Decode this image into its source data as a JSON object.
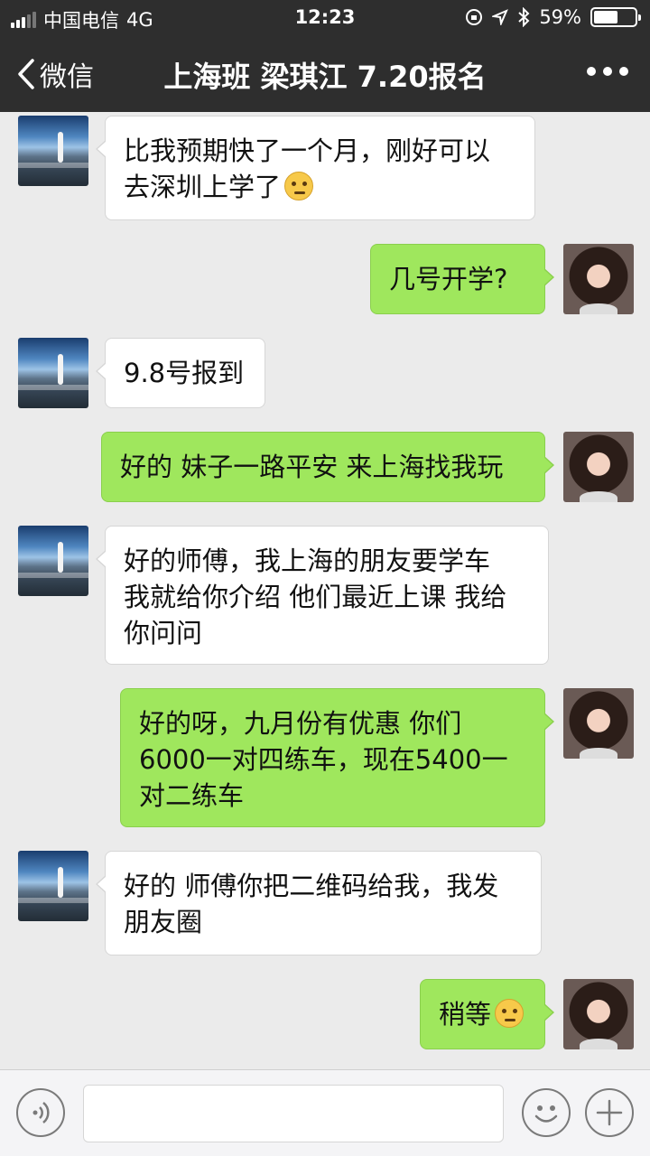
{
  "status_bar": {
    "carrier": "中国电信",
    "network": "4G",
    "time": "12:23",
    "battery_percent": "59%",
    "battery_level": 0.59
  },
  "nav": {
    "back_label": "微信",
    "title": "上海班 梁琪江 7.20报名"
  },
  "messages": [
    {
      "side": "in",
      "text": "比我预期快了一个月，刚好可以\n去深圳上学了",
      "emoji": "thinking-emoji"
    },
    {
      "side": "out",
      "text": "几号开学?"
    },
    {
      "side": "in",
      "text": "9.8号报到"
    },
    {
      "side": "out",
      "text": "好的 妹子一路平安 来上海找我玩"
    },
    {
      "side": "in",
      "text": "好的师傅，我上海的朋友要学车\n我就给你介绍 他们最近上课 我给\n你问问"
    },
    {
      "side": "out",
      "text": "好的呀，九月份有优惠 你们\n6000一对四练车，现在5400一\n对二练车"
    },
    {
      "side": "in",
      "text": "好的 师傅你把二维码给我，我发\n朋友圈"
    },
    {
      "side": "out",
      "text": "稍等",
      "emoji": "smirk-emoji"
    }
  ],
  "input": {
    "placeholder": ""
  },
  "colors": {
    "nav_bg": "#2e2e2e",
    "chat_bg": "#ebebeb",
    "bubble_out": "#9fe75d",
    "bubble_in": "#ffffff"
  }
}
